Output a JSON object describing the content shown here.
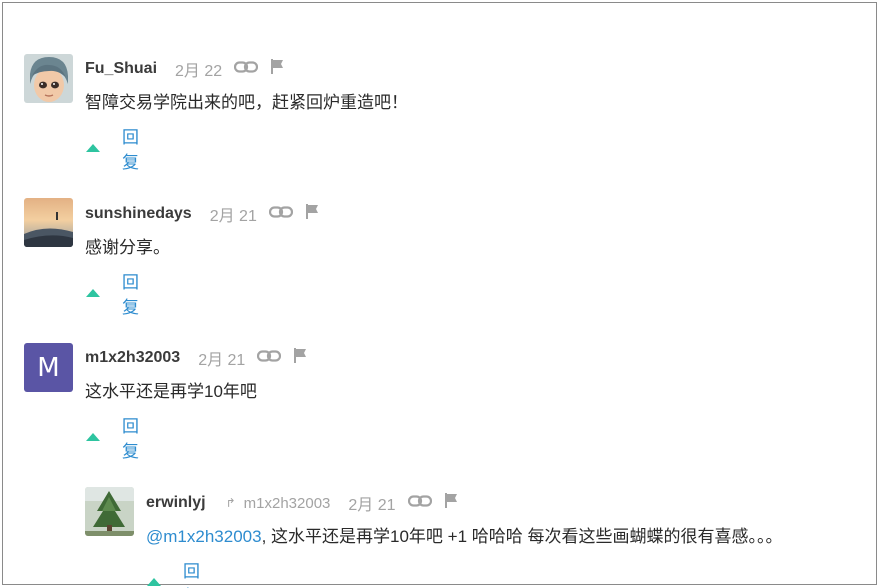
{
  "comments": [
    {
      "author": "Fu_Shuai",
      "date": "2月 22",
      "text": "智障交易学院出来的吧，赶紧回炉重造吧！",
      "reply_label": "回复",
      "avatar_icon": "cartoon-face-avatar"
    },
    {
      "author": "sunshinedays",
      "date": "2月 21",
      "text": "感谢分享。",
      "reply_label": "回复",
      "avatar_icon": "landscape-photo-avatar"
    },
    {
      "author": "m1x2h32003",
      "date": "2月 21",
      "text": "这水平还是再学10年吧",
      "reply_label": "回复",
      "avatar_letter": "M",
      "avatar_color": "#5a55a5"
    },
    {
      "author": "erwinlyj",
      "reply_to": "m1x2h32003",
      "date": "2月 21",
      "mention": "@m1x2h32003",
      "text": ", 这水平还是再学10年吧 +1 哈哈哈 每次看这些画蝴蝶的很有喜感。。。",
      "reply_label": "回复",
      "avatar_icon": "tree-photo-avatar"
    }
  ],
  "colors": {
    "accent": "#2e8ccf",
    "vote": "#2ec4a0",
    "muted": "#a3a3a3"
  }
}
